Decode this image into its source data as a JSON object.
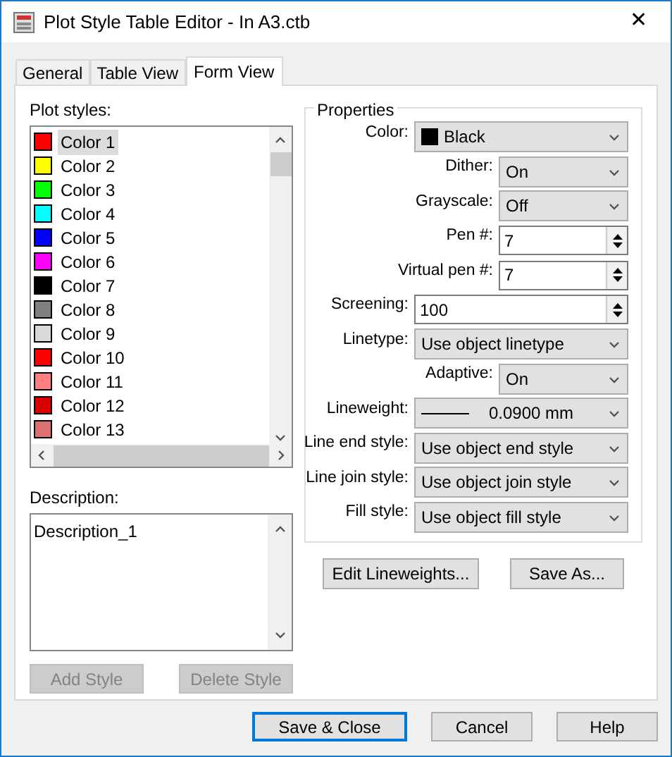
{
  "window": {
    "title": "Plot Style Table Editor - In A3.ctb",
    "close": "✕"
  },
  "tabs": [
    {
      "label": "General",
      "selected": false
    },
    {
      "label": "Table View",
      "selected": false
    },
    {
      "label": "Form View",
      "selected": true
    }
  ],
  "plot_styles": {
    "label": "Plot styles:",
    "items": [
      {
        "name": "Color 1",
        "color": "#ff0000",
        "selected": true
      },
      {
        "name": "Color 2",
        "color": "#ffff00",
        "selected": false
      },
      {
        "name": "Color 3",
        "color": "#00ff00",
        "selected": false
      },
      {
        "name": "Color 4",
        "color": "#00ffff",
        "selected": false
      },
      {
        "name": "Color 5",
        "color": "#0000ff",
        "selected": false
      },
      {
        "name": "Color 6",
        "color": "#ff00ff",
        "selected": false
      },
      {
        "name": "Color 7",
        "color": "#000000",
        "selected": false
      },
      {
        "name": "Color 8",
        "color": "#808080",
        "selected": false
      },
      {
        "name": "Color 9",
        "color": "#d9d9d9",
        "selected": false
      },
      {
        "name": "Color 10",
        "color": "#ff0000",
        "selected": false
      },
      {
        "name": "Color 11",
        "color": "#ff8080",
        "selected": false
      },
      {
        "name": "Color 12",
        "color": "#dd0000",
        "selected": false
      },
      {
        "name": "Color 13",
        "color": "#dd7070",
        "selected": false
      }
    ]
  },
  "description": {
    "label": "Description:",
    "value": "Description_1"
  },
  "style_buttons": [
    {
      "label": "Add Style",
      "disabled": true
    },
    {
      "label": "Delete Style",
      "disabled": true
    }
  ],
  "properties": {
    "title": "Properties",
    "fields": [
      {
        "kind": "colorselect",
        "label": "Color:",
        "value": "Black",
        "color": "#000000"
      },
      {
        "kind": "shortselect",
        "label": "Dither:",
        "value": "On"
      },
      {
        "kind": "shortselect",
        "label": "Grayscale:",
        "value": "Off"
      },
      {
        "kind": "shortspin",
        "label": "Pen #:",
        "value": "7"
      },
      {
        "kind": "shortspin",
        "label": "Virtual pen #:",
        "value": "7"
      },
      {
        "kind": "spin",
        "label": "Screening:",
        "value": "100"
      },
      {
        "kind": "select",
        "label": "Linetype:",
        "value": "Use object linetype"
      },
      {
        "kind": "shortselect",
        "label": "Adaptive:",
        "value": "On"
      },
      {
        "kind": "lineselect",
        "label": "Lineweight:",
        "value": "0.0900 mm"
      },
      {
        "kind": "select",
        "label": "Line end style:",
        "value": "Use object end style"
      },
      {
        "kind": "select",
        "label": "Line join style:",
        "value": "Use object join style"
      },
      {
        "kind": "select",
        "label": "Fill style:",
        "value": "Use object fill style"
      }
    ]
  },
  "property_buttons": [
    "Edit Lineweights...",
    "Save As..."
  ],
  "dialog_buttons": [
    {
      "label": "Save & Close",
      "default": true
    },
    {
      "label": "Cancel",
      "default": false
    },
    {
      "label": "Help",
      "default": false
    }
  ]
}
